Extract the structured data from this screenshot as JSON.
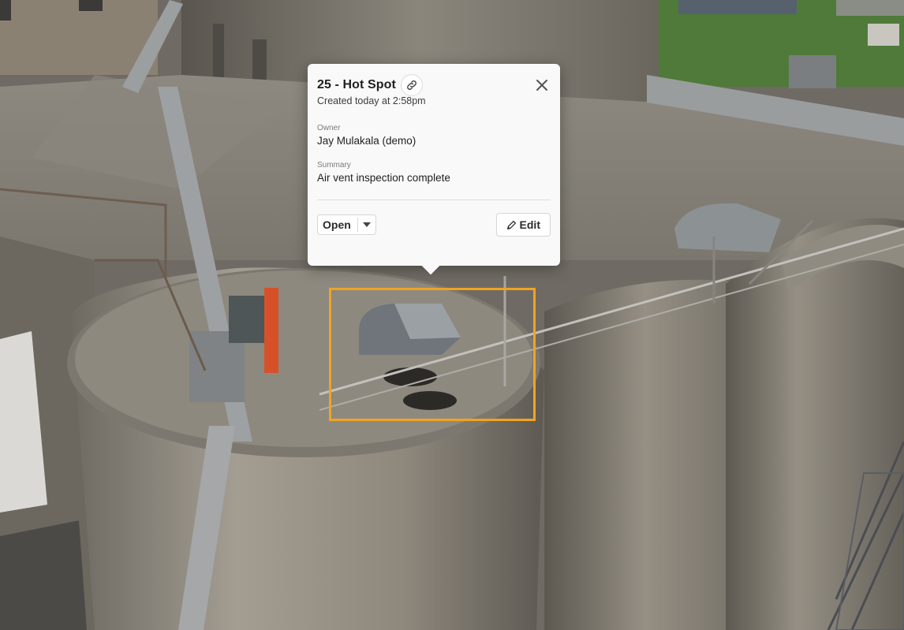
{
  "popover": {
    "title": "25 - Hot Spot",
    "created": "Created today at 2:58pm",
    "owner_label": "Owner",
    "owner_value": "Jay Mulakala (demo)",
    "summary_label": "Summary",
    "summary_value": "Air vent inspection complete",
    "status_value": "Open",
    "edit_label": "Edit"
  },
  "icons": {
    "link": "link-icon",
    "close": "close-icon",
    "caret": "caret-down-icon",
    "edit": "pencil-icon"
  },
  "colors": {
    "annotation_box": "#f0a422",
    "card_background": "#f9f9f9",
    "text_primary": "#1f1f1f"
  }
}
